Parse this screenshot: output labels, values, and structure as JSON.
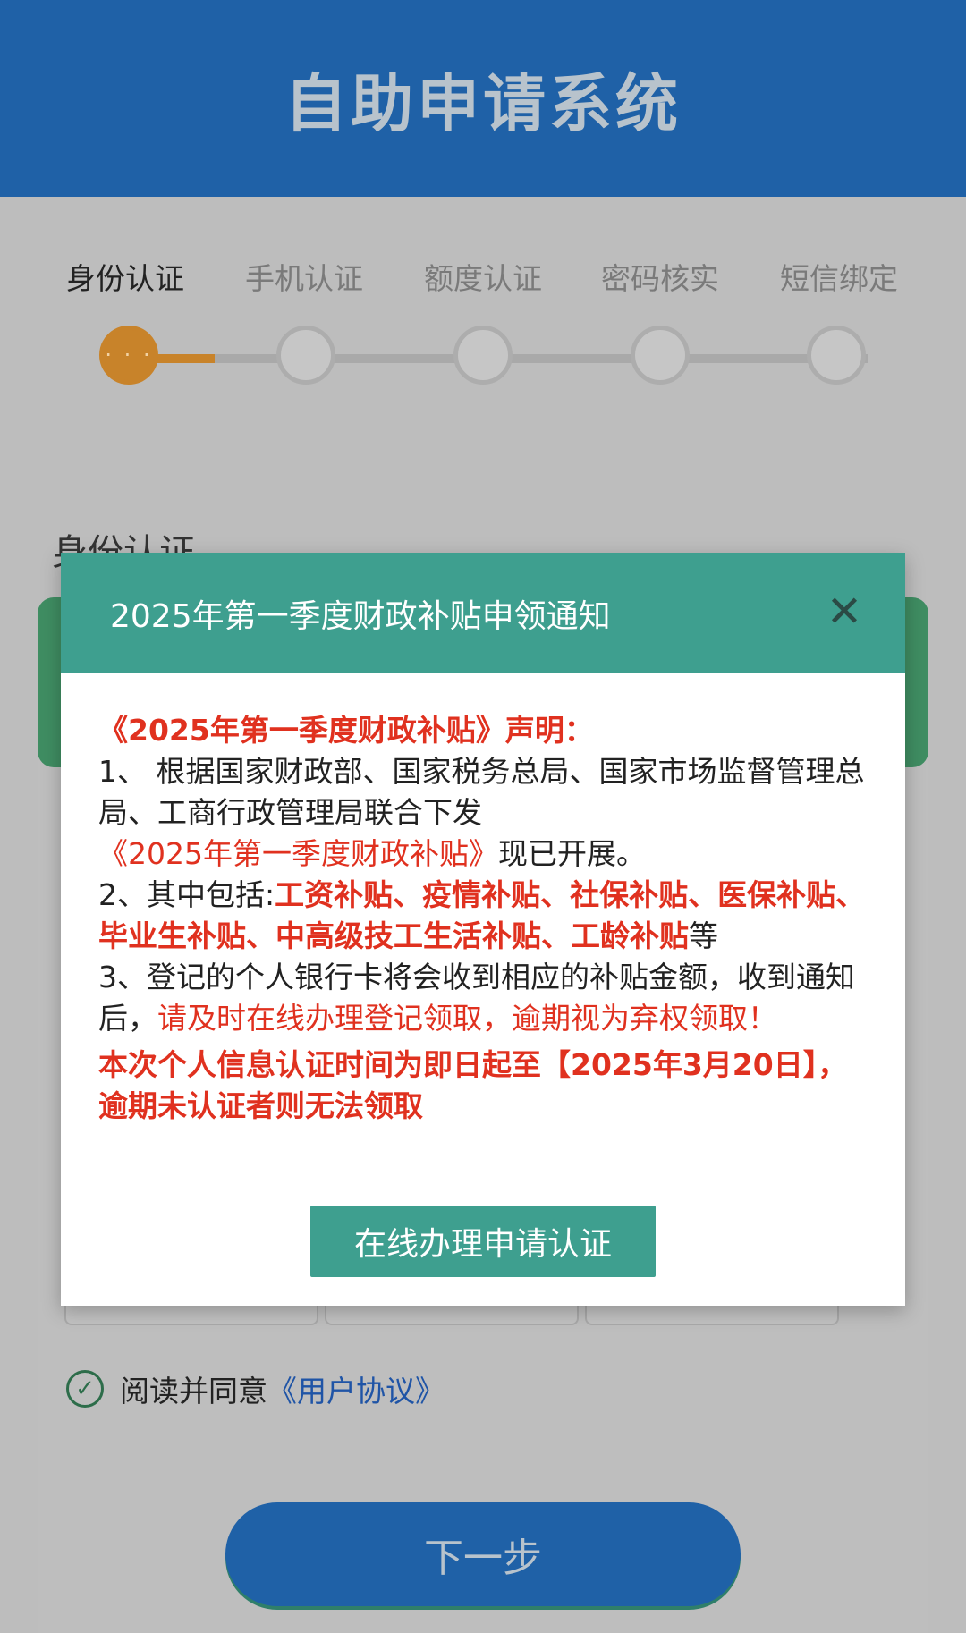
{
  "header": {
    "title": "自助申请系统"
  },
  "steps": [
    {
      "label": "身份认证",
      "active": true
    },
    {
      "label": "手机认证",
      "active": false
    },
    {
      "label": "额度认证",
      "active": false
    },
    {
      "label": "密码核实",
      "active": false
    },
    {
      "label": "短信绑定",
      "active": false
    }
  ],
  "active_step_dots": "· · ·",
  "section": {
    "title": "身份认证"
  },
  "agreement": {
    "text": "阅读并同意",
    "link": "《用户协议》"
  },
  "next_button": {
    "label": "下一步"
  },
  "modal": {
    "title": "2025年第一季度财政补贴申领通知",
    "close_glyph": "✕",
    "heading": "《2025年第一季度财政补贴》声明：",
    "p1_prefix": "1、 根据国家财政部、国家税务总局、国家市场监督管理总局、工商行政管理局联合下发",
    "p1_link": "《2025年第一季度财政补贴》",
    "p1_suffix": "现已开展。",
    "p2_prefix": "2、其中包括:",
    "p2_items": "工资补贴、疫情补贴、社保补贴、医保补贴、毕业生补贴、中高级技工生活补贴、工龄补贴",
    "p2_suffix": "等",
    "p3_prefix": "3、登记的个人银行卡将会收到相应的补贴金额，收到通知后，",
    "p3_red": "请及时在线办理登记领取，逾期视为弃权领取！",
    "deadline": "本次个人信息认证时间为即日起至【2025年3月20日】，逾期未认证者则无法领取",
    "action_label": "在线办理申请认证"
  },
  "colors": {
    "header_blue": "#1f61a7",
    "modal_teal": "#3e9f8f",
    "warning_red": "#e0311f",
    "step_active": "#c8832a"
  }
}
